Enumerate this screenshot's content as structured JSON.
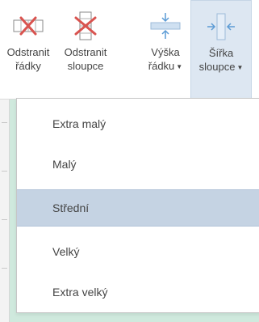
{
  "ribbon": {
    "buttons": [
      {
        "line1": "Odstranit",
        "line2": "řádky",
        "icon": "delete-rows-icon",
        "has_dropdown": false
      },
      {
        "line1": "Odstranit",
        "line2": "sloupce",
        "icon": "delete-columns-icon",
        "has_dropdown": false
      },
      {
        "line1": "Výška",
        "line2": "řádku",
        "icon": "row-height-icon",
        "has_dropdown": true
      },
      {
        "line1": "Šířka",
        "line2": "sloupce",
        "icon": "column-width-icon",
        "has_dropdown": true,
        "active": true
      }
    ]
  },
  "menu": {
    "items": [
      {
        "label": "Extra malý",
        "selected": false
      },
      {
        "label": "Malý",
        "selected": false
      },
      {
        "label": "Střední",
        "selected": true
      },
      {
        "label": "Velký",
        "selected": false
      },
      {
        "label": "Extra velký",
        "selected": false
      }
    ]
  },
  "colors": {
    "accent_red": "#d9534f",
    "icon_blue": "#5b9bd5",
    "selected_bg": "#c5d3e3"
  }
}
